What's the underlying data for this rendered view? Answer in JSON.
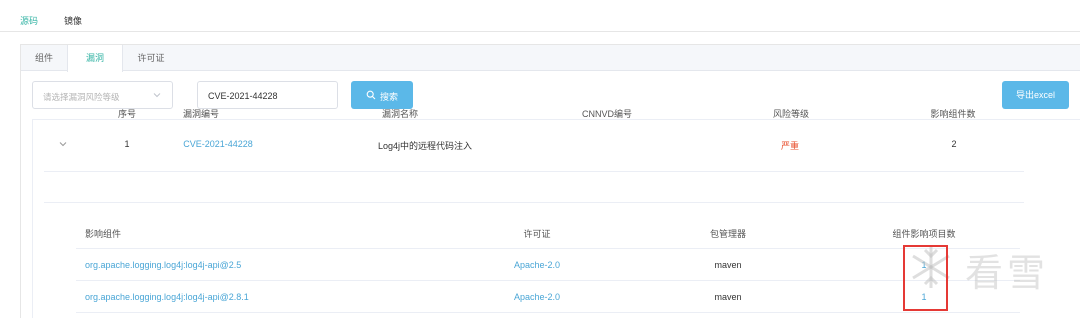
{
  "top_tabs": [
    {
      "label": "源码"
    },
    {
      "label": "镜像"
    }
  ],
  "sub_tabs": [
    {
      "label": "组件"
    },
    {
      "label": "漏洞"
    },
    {
      "label": "许可证"
    }
  ],
  "filters": {
    "risk_select_placeholder": "请选择漏洞风险等级",
    "search_value": "CVE-2021-44228",
    "search_button": "搜索",
    "export_button": "导出excel"
  },
  "table": {
    "headers": [
      "序号",
      "漏洞编号",
      "漏洞名称",
      "CNNVD编号",
      "风险等级",
      "影响组件数"
    ],
    "rows": [
      {
        "index": "1",
        "cve": "CVE-2021-44228",
        "name": "Log4j中的远程代码注入",
        "cnnvd": "",
        "risk": "严重",
        "components": "2"
      }
    ]
  },
  "sub_table": {
    "headers": [
      "影响组件",
      "许可证",
      "包管理器",
      "组件影响项目数"
    ],
    "rows": [
      {
        "component": "org.apache.logging.log4j:log4j-api@2.5",
        "license": "Apache-2.0",
        "manager": "maven",
        "projects": "1"
      },
      {
        "component": "org.apache.logging.log4j:log4j-api@2.8.1",
        "license": "Apache-2.0",
        "manager": "maven",
        "projects": "1"
      }
    ]
  },
  "watermark": {
    "text": "看雪",
    "icon": "snowflake-logo-icon"
  },
  "colors": {
    "accent": "#37b5a6",
    "button": "#5bb8e8",
    "link": "#4aa6d6",
    "severe": "#e8502f",
    "highlight": "#e53935"
  }
}
